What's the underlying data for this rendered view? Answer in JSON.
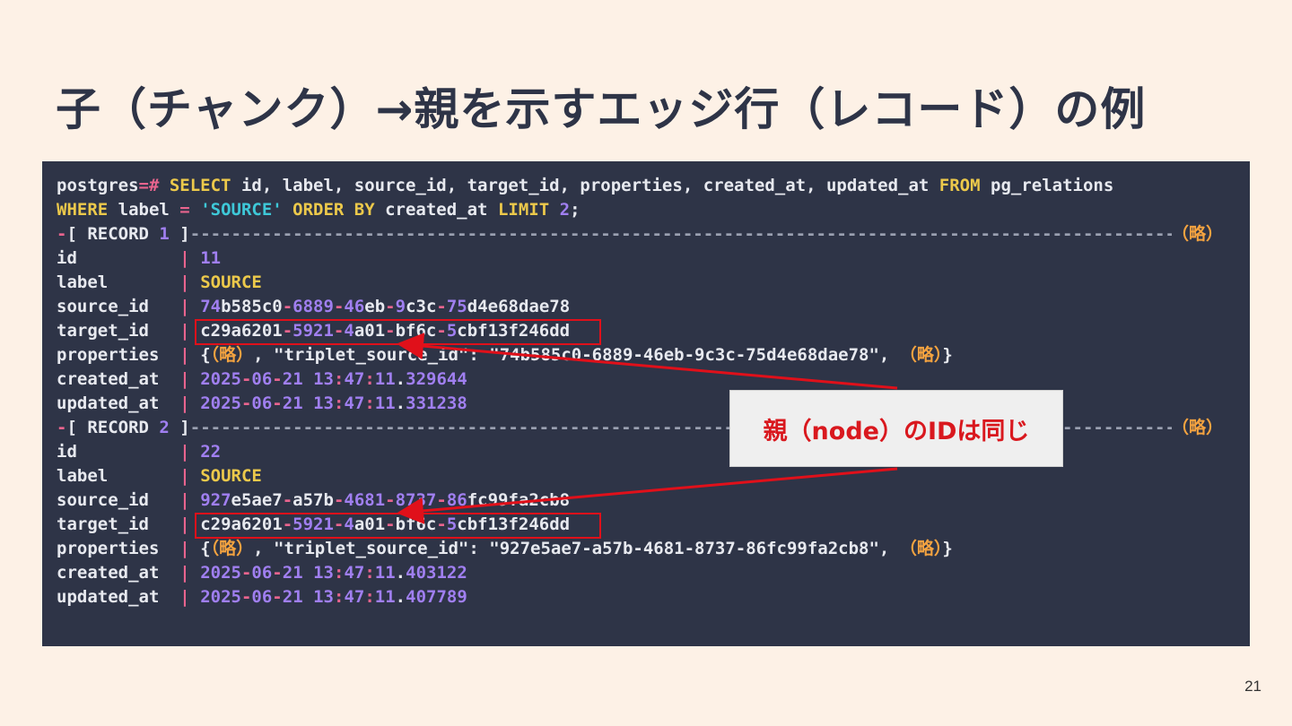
{
  "slide": {
    "title": "子（チャンク）→親を示すエッジ行（レコード）の例",
    "page_number": "21"
  },
  "terminal": {
    "prompt": "postgres",
    "prompt_op": "=#",
    "kw_select": "SELECT",
    "select_cols": " id, label, source_id, target_id, properties, created_at, updated_at ",
    "kw_from": "FROM",
    "table": " pg_relations",
    "kw_where": "WHERE",
    "where_col": " label ",
    "eq": "=",
    "str_source": "'SOURCE'",
    "kw_order": "ORDER BY",
    "order_col": " created_at ",
    "kw_limit": "LIMIT",
    "limit_val": "2",
    "semicolon": ";",
    "abbrev": "（略）",
    "sep": "|",
    "records": [
      {
        "header_prefix": "-[ RECORD ",
        "number": "1",
        "header_suffix": " ]",
        "id_label": "id          ",
        "id": "11",
        "label_label": "label       ",
        "label": "SOURCE",
        "source_id_label": "source_id   ",
        "source_id": [
          "74",
          "b585c0",
          "-",
          "6889",
          "-",
          "46",
          "eb",
          "-",
          "9",
          "c3c",
          "-",
          "75",
          "d4e68dae78"
        ],
        "target_id_label": "target_id   ",
        "target_id": [
          "c29a6201",
          "-",
          "5921",
          "-",
          "4",
          "a01",
          "-",
          "bf6c",
          "-",
          "5",
          "cbf13f246dd"
        ],
        "properties_label": "properties  ",
        "properties_open": "{",
        "properties_mid": ", \"triplet_source_id\": \"74b585c0-6889-46eb-9c3c-75d4e68dae78\", ",
        "properties_close": "}",
        "created_at_label": "created_at  ",
        "created_at": [
          "2025",
          "-",
          "06",
          "-",
          "21",
          " ",
          "13",
          ":",
          "47",
          ":",
          "11",
          ".",
          "329644"
        ],
        "updated_at_label": "updated_at  ",
        "updated_at": [
          "2025",
          "-",
          "06",
          "-",
          "21",
          " ",
          "13",
          ":",
          "47",
          ":",
          "11",
          ".",
          "331238"
        ]
      },
      {
        "header_prefix": "-[ RECORD ",
        "number": "2",
        "header_suffix": " ]",
        "id_label": "id          ",
        "id": "22",
        "label_label": "label       ",
        "label": "SOURCE",
        "source_id_label": "source_id   ",
        "source_id": [
          "927",
          "e5ae7",
          "-",
          "a57b",
          "-",
          "4681",
          "-",
          "8737",
          "-",
          "86",
          "fc99fa2cb8"
        ],
        "target_id_label": "target_id   ",
        "target_id": [
          "c29a6201",
          "-",
          "5921",
          "-",
          "4",
          "a01",
          "-",
          "bf6c",
          "-",
          "5",
          "cbf13f246dd"
        ],
        "properties_label": "properties  ",
        "properties_open": "{",
        "properties_mid": ", \"triplet_source_id\": \"927e5ae7-a57b-4681-8737-86fc99fa2cb8\", ",
        "properties_close": "}",
        "created_at_label": "created_at  ",
        "created_at": [
          "2025",
          "-",
          "06",
          "-",
          "21",
          " ",
          "13",
          ":",
          "47",
          ":",
          "11",
          ".",
          "403122"
        ],
        "updated_at_label": "updated_at  ",
        "updated_at": [
          "2025",
          "-",
          "06",
          "-",
          "21",
          " ",
          "13",
          ":",
          "47",
          ":",
          "11",
          ".",
          "407789"
        ]
      }
    ]
  },
  "callout": {
    "text": "親（node）のIDは同じ"
  },
  "colors": {
    "background": "#fdf1e6",
    "terminal_bg": "#2e3447",
    "keyword": "#ecc94b",
    "number": "#a07ff0",
    "operator": "#e8648e",
    "string": "#3ec8d8",
    "abbrev": "#f4a340",
    "highlight": "#e0101a"
  }
}
